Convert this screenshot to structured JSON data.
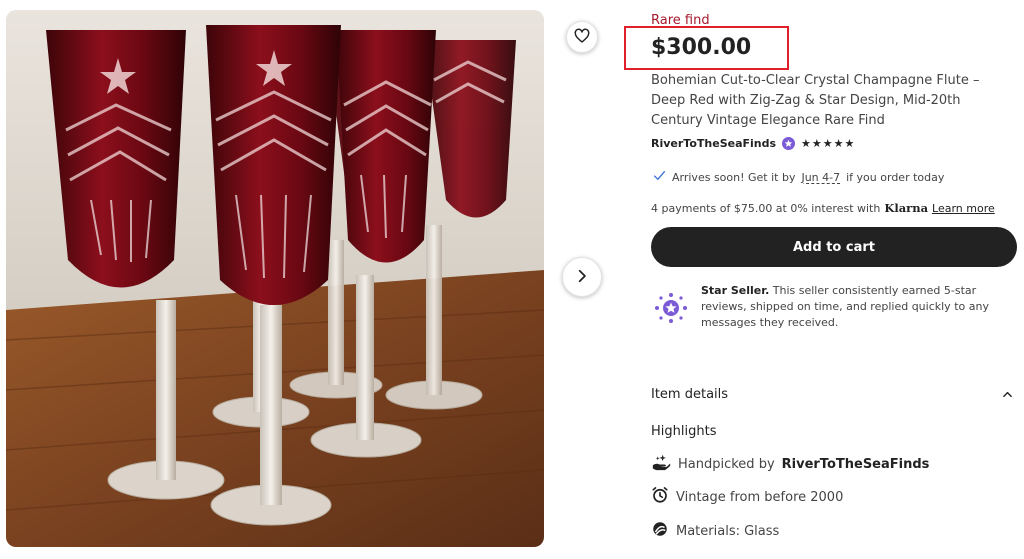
{
  "product": {
    "rare_label": "Rare find",
    "price": "$300.00",
    "title": "Bohemian Cut-to-Clear Crystal Champagne Flute – Deep Red with Zig-Zag & Star Design, Mid-20th Century Vintage Elegance Rare Find"
  },
  "shop": {
    "name": "RiverToTheSeaFinds",
    "rating": 5,
    "stars": [
      "★",
      "★",
      "★",
      "★",
      "★"
    ]
  },
  "shipping": {
    "prefix": "Arrives soon! Get it by",
    "date": "Jun 4-7",
    "suffix": "if you order today"
  },
  "payment": {
    "text": "4 payments of $75.00 at 0% interest with",
    "brand": "Klarna",
    "link": "Learn more"
  },
  "cart": {
    "label": "Add to cart"
  },
  "star_seller": {
    "title": "Star Seller.",
    "text": "This seller consistently earned 5-star reviews, shipped on time, and replied quickly to any messages they received."
  },
  "details": {
    "title": "Item details",
    "highlights_title": "Highlights",
    "handpicked_prefix": "Handpicked by",
    "handpicked_shop": "RiverToTheSeaFinds",
    "vintage": "Vintage from before 2000",
    "materials": "Materials: Glass"
  },
  "colors": {
    "accent_red": "#a61a2e",
    "highlight_box": "#e0202a",
    "cart_bg": "#222222",
    "star_seller_purple": "#7b5bd6"
  },
  "icons": {
    "favorite": "heart-icon",
    "next": "chevron-right-icon",
    "collapse": "chevron-up-icon",
    "verified": "check-icon"
  }
}
